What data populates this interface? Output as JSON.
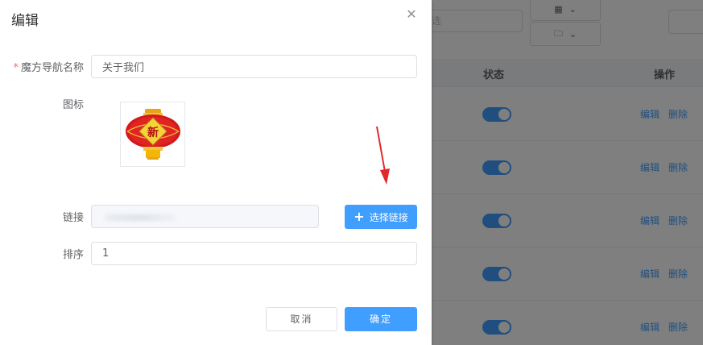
{
  "background": {
    "search_placeholder": "选",
    "table_headers": {
      "status": "状态",
      "ops": "操作"
    },
    "row_actions": {
      "edit": "编辑",
      "delete": "删除"
    },
    "rows": [
      {
        "enabled": true
      },
      {
        "enabled": true
      },
      {
        "enabled": true
      },
      {
        "enabled": true
      },
      {
        "enabled": true
      }
    ]
  },
  "dialog": {
    "title": "编辑",
    "close_icon": "close-icon",
    "fields": {
      "name": {
        "label": "魔方导航名称",
        "required_mark": "*",
        "value": "关于我们"
      },
      "icon": {
        "label": "图标",
        "image": "new-year-lantern-icon"
      },
      "link": {
        "label": "链接",
        "value": ""
      },
      "sort": {
        "label": "排序",
        "value": "1"
      }
    },
    "select_link_button": "选择链接",
    "cancel_button": "取消",
    "confirm_button": "确定"
  },
  "colors": {
    "primary": "#409eff",
    "danger": "#f56c6c",
    "mask": "rgba(0,0,0,0.5)",
    "annotation_arrow": "#e02b2b"
  }
}
